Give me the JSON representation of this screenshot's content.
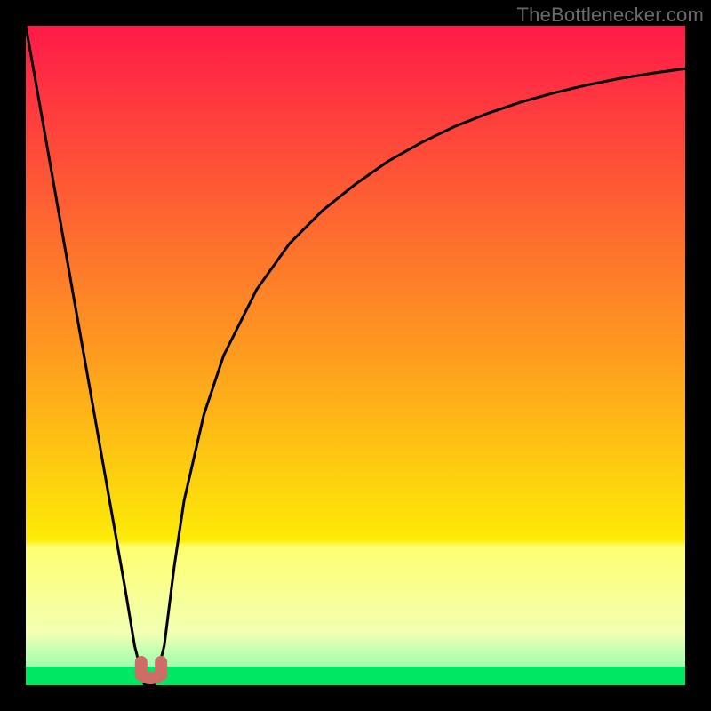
{
  "watermark_text": "TheBottlenecker.com",
  "gradient_colors": {
    "c0": "#ff1a49",
    "c1": "#fe9c1f",
    "c2": "#fdeb07",
    "c3": "#feff70",
    "c4": "#f3ffb2",
    "c5": "#9cffb0",
    "c6": "#00e763"
  },
  "chart_data": {
    "type": "line",
    "title": "",
    "xlabel": "",
    "ylabel": "",
    "xlim": [
      0,
      100
    ],
    "ylim": [
      0,
      100
    ],
    "x": [
      0,
      3,
      6,
      9,
      12,
      15,
      16.5,
      18,
      19.5,
      21,
      22.5,
      24,
      27,
      30,
      35,
      40,
      45,
      50,
      55,
      60,
      65,
      70,
      75,
      80,
      85,
      90,
      95,
      100
    ],
    "values": [
      100,
      83,
      66,
      49,
      32,
      15,
      6,
      0,
      0,
      6,
      18,
      28,
      41,
      50,
      60,
      67,
      72,
      76,
      79.5,
      82.3,
      84.7,
      86.7,
      88.4,
      89.8,
      91,
      92,
      92.8,
      93.5
    ],
    "minimum_marker": {
      "x_start": 17.5,
      "x_end": 20.5,
      "y": 0
    },
    "annotations": []
  }
}
